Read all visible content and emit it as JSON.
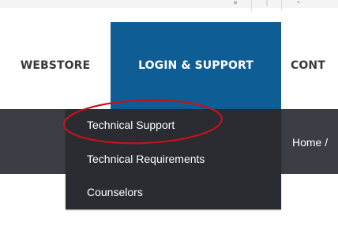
{
  "header": {
    "social_icons": [
      "google-plus-icon",
      "facebook-icon",
      "linkedin-icon"
    ]
  },
  "nav": {
    "items": [
      {
        "label": "WEBSTORE"
      },
      {
        "label": "LOGIN & SUPPORT",
        "active": true
      },
      {
        "label": "CONT"
      }
    ],
    "active_color": "#0e5d94"
  },
  "dropdown": {
    "items": [
      {
        "label": "Technical Support",
        "highlighted": true
      },
      {
        "label": "Technical Requirements"
      },
      {
        "label": "Counselors"
      }
    ],
    "background": "#2a2c31"
  },
  "breadcrumb": {
    "text": "Home /"
  },
  "annotation": {
    "color": "#c0141c"
  }
}
